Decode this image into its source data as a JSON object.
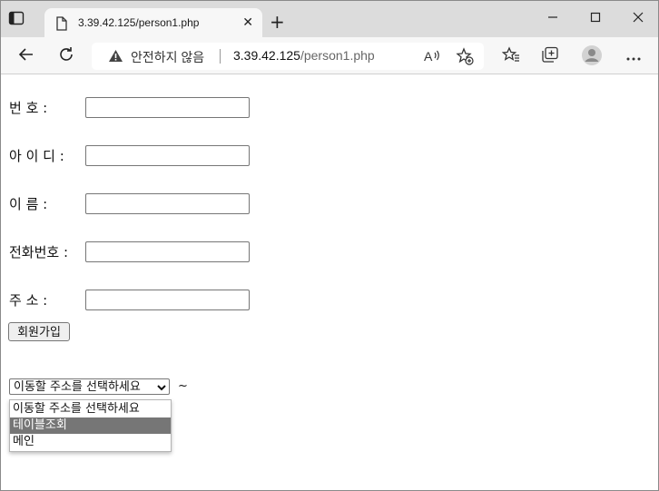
{
  "browser": {
    "tab_title": "3.39.42.125/person1.php",
    "security_label": "안전하지 않음",
    "url_host": "3.39.42.125",
    "url_path": "/person1.php"
  },
  "form": {
    "fields": [
      {
        "label": "번 호 :",
        "value": ""
      },
      {
        "label": "아 이 디 :",
        "value": ""
      },
      {
        "label": "이 름 :",
        "value": ""
      },
      {
        "label": "전화번호 :",
        "value": ""
      },
      {
        "label": "주 소 :",
        "value": ""
      }
    ],
    "submit_label": "회원가입"
  },
  "navigation": {
    "select_value": "이동할 주소를 선택하세요",
    "suffix": "~",
    "options": [
      {
        "label": "이동할 주소를 선택하세요",
        "selected": false
      },
      {
        "label": "테이블조회",
        "selected": true
      },
      {
        "label": "메인",
        "selected": false
      }
    ]
  },
  "colors": {
    "highlight": "#767676",
    "tabstrip": "#dcdcdc"
  }
}
